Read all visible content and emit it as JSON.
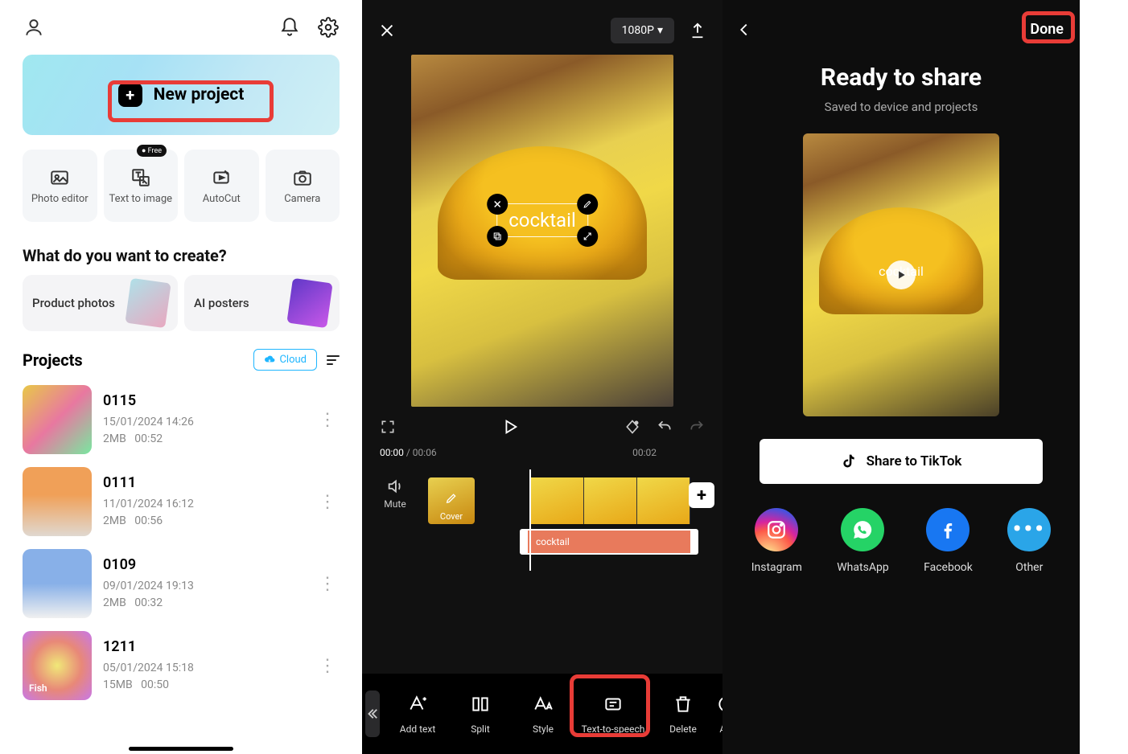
{
  "screen1": {
    "new_project_label": "New project",
    "tools": [
      {
        "label": "Photo editor"
      },
      {
        "label": "Text to image",
        "badge": "Free"
      },
      {
        "label": "AutoCut"
      },
      {
        "label": "Camera"
      }
    ],
    "create_section_title": "What do you want to create?",
    "create_cards": [
      {
        "label": "Product photos"
      },
      {
        "label": "AI posters"
      }
    ],
    "projects_title": "Projects",
    "cloud_label": "Cloud",
    "projects": [
      {
        "name": "0115",
        "date": "15/01/2024 14:26",
        "size": "2MB",
        "duration": "00:52"
      },
      {
        "name": "0111",
        "date": "11/01/2024 16:12",
        "size": "2MB",
        "duration": "00:56"
      },
      {
        "name": "0109",
        "date": "09/01/2024 19:13",
        "size": "2MB",
        "duration": "00:32"
      },
      {
        "name": "1211",
        "date": "05/01/2024 15:18",
        "size": "15MB",
        "duration": "00:50"
      }
    ]
  },
  "screen2": {
    "resolution_label": "1080P",
    "text_overlay": "cocktail",
    "time_current": "00:00",
    "time_total": "00:06",
    "timeline_tick": "00:02",
    "mute_label": "Mute",
    "cover_label": "Cover",
    "text_clip_label": "cocktail",
    "toolbar": [
      {
        "label": "Add text"
      },
      {
        "label": "Split"
      },
      {
        "label": "Style"
      },
      {
        "label": "Text-to-speech"
      },
      {
        "label": "Delete"
      },
      {
        "label": "Ani"
      }
    ]
  },
  "screen3": {
    "done_label": "Done",
    "title": "Ready to share",
    "subtitle": "Saved to device and projects",
    "preview_text": "cocktail",
    "tiktok_label": "Share to TikTok",
    "share_targets": [
      {
        "label": "Instagram"
      },
      {
        "label": "WhatsApp"
      },
      {
        "label": "Facebook"
      },
      {
        "label": "Other"
      }
    ]
  }
}
